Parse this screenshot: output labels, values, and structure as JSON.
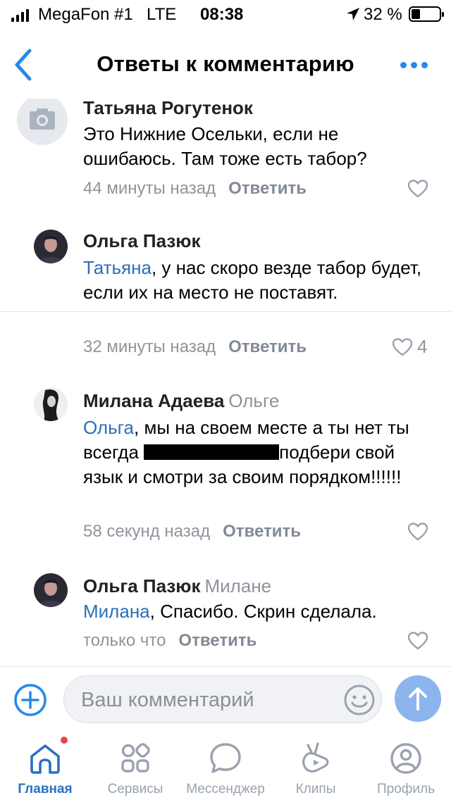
{
  "status_bar": {
    "carrier": "MegaFon #1",
    "network": "LTE",
    "time": "08:38",
    "battery_percent": "32 %",
    "battery_level": 0.32
  },
  "nav": {
    "title": "Ответы к комментарию",
    "accent_color": "#2688eb"
  },
  "comments": [
    {
      "author": "Татьяна Рогутенок",
      "reply_to": "",
      "text": "Это Нижние Осельки, если не ошибаюсь. Там тоже есть табор?",
      "time": "44 минуты назад",
      "reply_label": "Ответить",
      "likes": ""
    },
    {
      "author": "Ольга Пазюк",
      "reply_to": "",
      "mention": "Татьяна",
      "text": ", у нас скоро везде табор будет, если их на место не поставят.",
      "time": "32 минуты назад",
      "reply_label": "Ответить",
      "likes": "4"
    },
    {
      "author": "Милана Адаева",
      "reply_to": "Ольге",
      "mention": "Ольга",
      "text_part1": ", мы на своем месте а ты нет ты всегда ",
      "text_part2": "подбери свой язык и смотри за своим порядком!!!!!!",
      "time": "58 секунд назад",
      "reply_label": "Ответить",
      "likes": ""
    },
    {
      "author": "Ольга Пазюк",
      "reply_to": "Милане",
      "mention": "Милана",
      "text": ", Спасибо. Скрин сделала.",
      "time": "только что",
      "reply_label": "Ответить",
      "likes": ""
    }
  ],
  "composer": {
    "placeholder": "Ваш комментарий"
  },
  "tabs": [
    {
      "label": "Главная",
      "icon": "home-icon",
      "active": true,
      "has_badge": true
    },
    {
      "label": "Сервисы",
      "icon": "services-icon",
      "active": false
    },
    {
      "label": "Мессенджер",
      "icon": "messenger-icon",
      "active": false
    },
    {
      "label": "Клипы",
      "icon": "clips-icon",
      "active": false
    },
    {
      "label": "Профиль",
      "icon": "profile-icon",
      "active": false
    }
  ]
}
